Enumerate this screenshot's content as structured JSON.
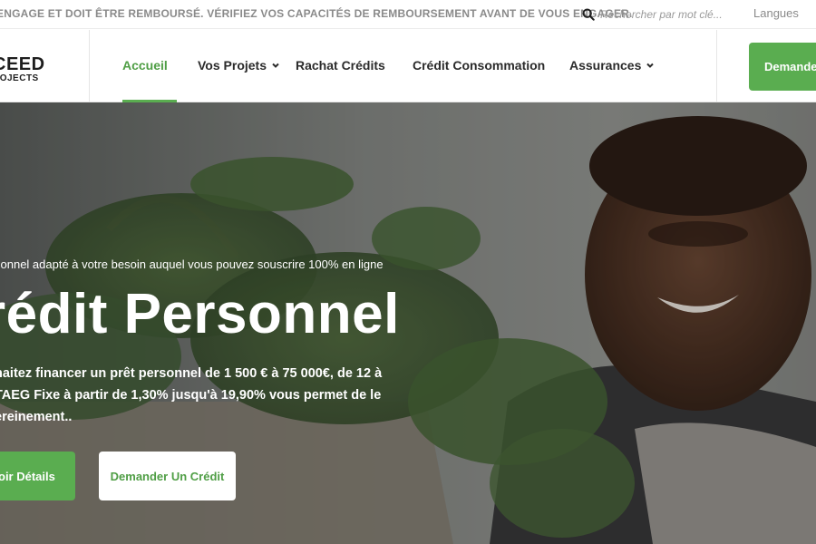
{
  "topbar": {
    "warning": "ENGAGE ET DOIT ÊTRE REMBOURSÉ. VÉRIFIEZ VOS CAPACITÉS DE REMBOURSEMENT AVANT DE VOUS ENGAGER.",
    "search_placeholder": "Rechercher par mot clé...",
    "language_label": "Langues"
  },
  "header": {
    "logo_line1": "CEED",
    "logo_line2": "ROJECTS",
    "nav": [
      {
        "label": "Accueil",
        "active": true,
        "dropdown": false
      },
      {
        "label": "Vos Projets",
        "active": false,
        "dropdown": true
      },
      {
        "label": "Rachat Crédits",
        "active": false,
        "dropdown": false
      },
      {
        "label": "Crédit Consommation",
        "active": false,
        "dropdown": false
      },
      {
        "label": "Assurances",
        "active": false,
        "dropdown": true
      }
    ],
    "cta_label": "Demande"
  },
  "hero": {
    "subtitle": "sonnel adapté à votre besoin auquel vous pouvez souscrire 100% en ligne",
    "title": "rédit Personnel",
    "description_lines": [
      "haitez financer un prêt personnel de 1 500 € à 75 000€, de 12 à",
      "TAEG Fixe à partir de 1,30% jusqu'à 19,90% vous permet de le",
      "ereinement.."
    ],
    "primary_button": "oir Détails",
    "secondary_button": "Demander Un Crédit"
  },
  "colors": {
    "brand_green": "#5aad50",
    "active_nav": "#4f9e45",
    "text_dark": "#2b2b2b",
    "muted": "#8a8a8a"
  },
  "icons": {
    "search": "search-icon",
    "dropdown": "chevron-down-icon"
  }
}
